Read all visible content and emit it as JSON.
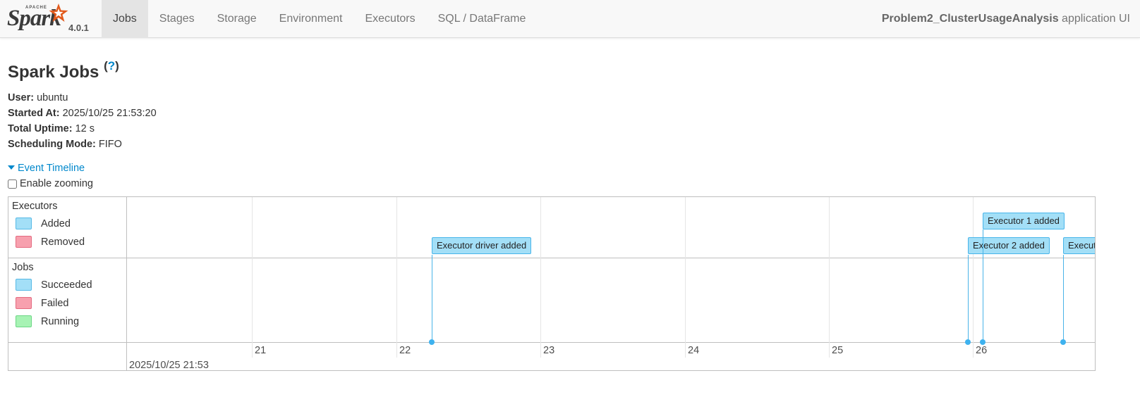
{
  "brand": {
    "apache": "APACHE",
    "name": "Spark",
    "version": "4.0.1"
  },
  "nav": {
    "tabs": [
      {
        "label": "Jobs",
        "active": true
      },
      {
        "label": "Stages"
      },
      {
        "label": "Storage"
      },
      {
        "label": "Environment"
      },
      {
        "label": "Executors"
      },
      {
        "label": "SQL / DataFrame"
      }
    ],
    "app_name": "Problem2_ClusterUsageAnalysis",
    "app_suffix": " application UI"
  },
  "page": {
    "title": "Spark Jobs",
    "help": "?",
    "summary": {
      "user_label": "User:",
      "user": "ubuntu",
      "started_label": "Started At:",
      "started": "2025/10/25 21:53:20",
      "uptime_label": "Total Uptime:",
      "uptime": "12 s",
      "mode_label": "Scheduling Mode:",
      "mode": "FIFO"
    }
  },
  "timeline": {
    "toggle_label": "Event Timeline",
    "zoom_label": "Enable zooming",
    "zoom_enabled": false,
    "executors_group": "Executors",
    "executor_legend": [
      {
        "label": "Added",
        "color": "#a3dff7"
      },
      {
        "label": "Removed",
        "color": "#f7a0ae"
      }
    ],
    "jobs_group": "Jobs",
    "job_legend": [
      {
        "label": "Succeeded",
        "color": "#a3dff7"
      },
      {
        "label": "Failed",
        "color": "#f7a0ae"
      },
      {
        "label": "Running",
        "color": "#a7f3b4"
      }
    ],
    "ticks": [
      "21",
      "22",
      "23",
      "24",
      "25",
      "26"
    ],
    "date_label": "2025/10/25 21:53",
    "events": [
      {
        "label": "Executor driver added"
      },
      {
        "label": "Executor 2 added"
      },
      {
        "label": "Executor 1 added"
      },
      {
        "label": "Execut"
      }
    ]
  }
}
